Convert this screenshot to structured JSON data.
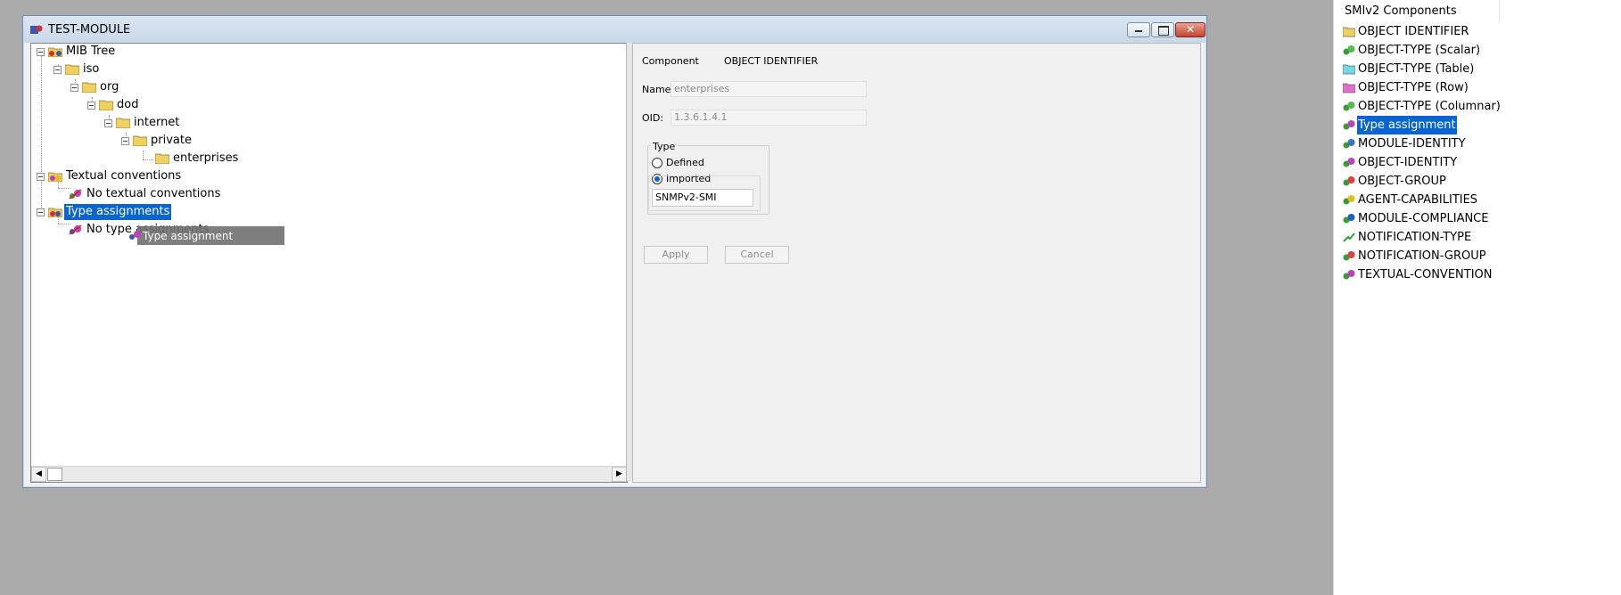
{
  "window": {
    "title": "TEST-MODULE",
    "minimize_glyph": "—",
    "maximize_glyph": "□",
    "close_glyph": "✕"
  },
  "tree": {
    "root": "MIB Tree",
    "iso": "iso",
    "org": "org",
    "dod": "dod",
    "internet": "internet",
    "private": "private",
    "enterprises": "enterprises",
    "textual_conventions": "Textual conventions",
    "no_textual_conventions": "No textual conventions",
    "type_assignments": "Type assignments",
    "no_type_assignments": "No type assignments"
  },
  "drag_ghost": {
    "label": "Type assignment"
  },
  "scrollbar": {
    "left_arrow": "◀",
    "right_arrow": "▶"
  },
  "properties": {
    "component_label": "Component",
    "component_value": "OBJECT IDENTIFIER",
    "name_label": "Name:",
    "name_value": "enterprises",
    "oid_label": "OID:",
    "oid_value": "1.3.6.1.4.1",
    "type_group_label": "Type",
    "defined_label": "Defined",
    "imported_label": "Imported",
    "imported_selected": true,
    "imported_module": "SNMPv2-SMI",
    "apply_label": "Apply",
    "cancel_label": "Cancel"
  },
  "palette": {
    "header": "SMIv2 Components",
    "items": [
      {
        "label": "OBJECT IDENTIFIER",
        "icon": "folder-icon",
        "color": "#f0d060"
      },
      {
        "label": "OBJECT-TYPE (Scalar)",
        "icon": "scalar-icon",
        "color": "#4cc24c"
      },
      {
        "label": "OBJECT-TYPE (Table)",
        "icon": "table-icon",
        "color": "#70d8e8"
      },
      {
        "label": "OBJECT-TYPE (Row)",
        "icon": "row-icon",
        "color": "#e070d0"
      },
      {
        "label": "OBJECT-TYPE (Columnar)",
        "icon": "columnar-icon",
        "color": "#58b858"
      },
      {
        "label": "Type assignment",
        "icon": "type-assignment-icon",
        "color": "#c040c0",
        "selected": true
      },
      {
        "label": "MODULE-IDENTITY",
        "icon": "module-identity-icon",
        "color": "#4070c0"
      },
      {
        "label": "OBJECT-IDENTITY",
        "icon": "object-identity-icon",
        "color": "#c040c0"
      },
      {
        "label": "OBJECT-GROUP",
        "icon": "object-group-icon",
        "color": "#e04040"
      },
      {
        "label": "AGENT-CAPABILITIES",
        "icon": "agent-capabilities-icon",
        "color": "#e0c020"
      },
      {
        "label": "MODULE-COMPLIANCE",
        "icon": "module-compliance-icon",
        "color": "#2060c0"
      },
      {
        "label": "NOTIFICATION-TYPE",
        "icon": "notification-type-icon",
        "color": "#30a030"
      },
      {
        "label": "NOTIFICATION-GROUP",
        "icon": "notification-group-icon",
        "color": "#e04040"
      },
      {
        "label": "TEXTUAL-CONVENTION",
        "icon": "textual-convention-icon",
        "color": "#c040c0"
      }
    ]
  },
  "colors": {
    "selection": "#0a64d2",
    "desktop": "#ababab"
  }
}
